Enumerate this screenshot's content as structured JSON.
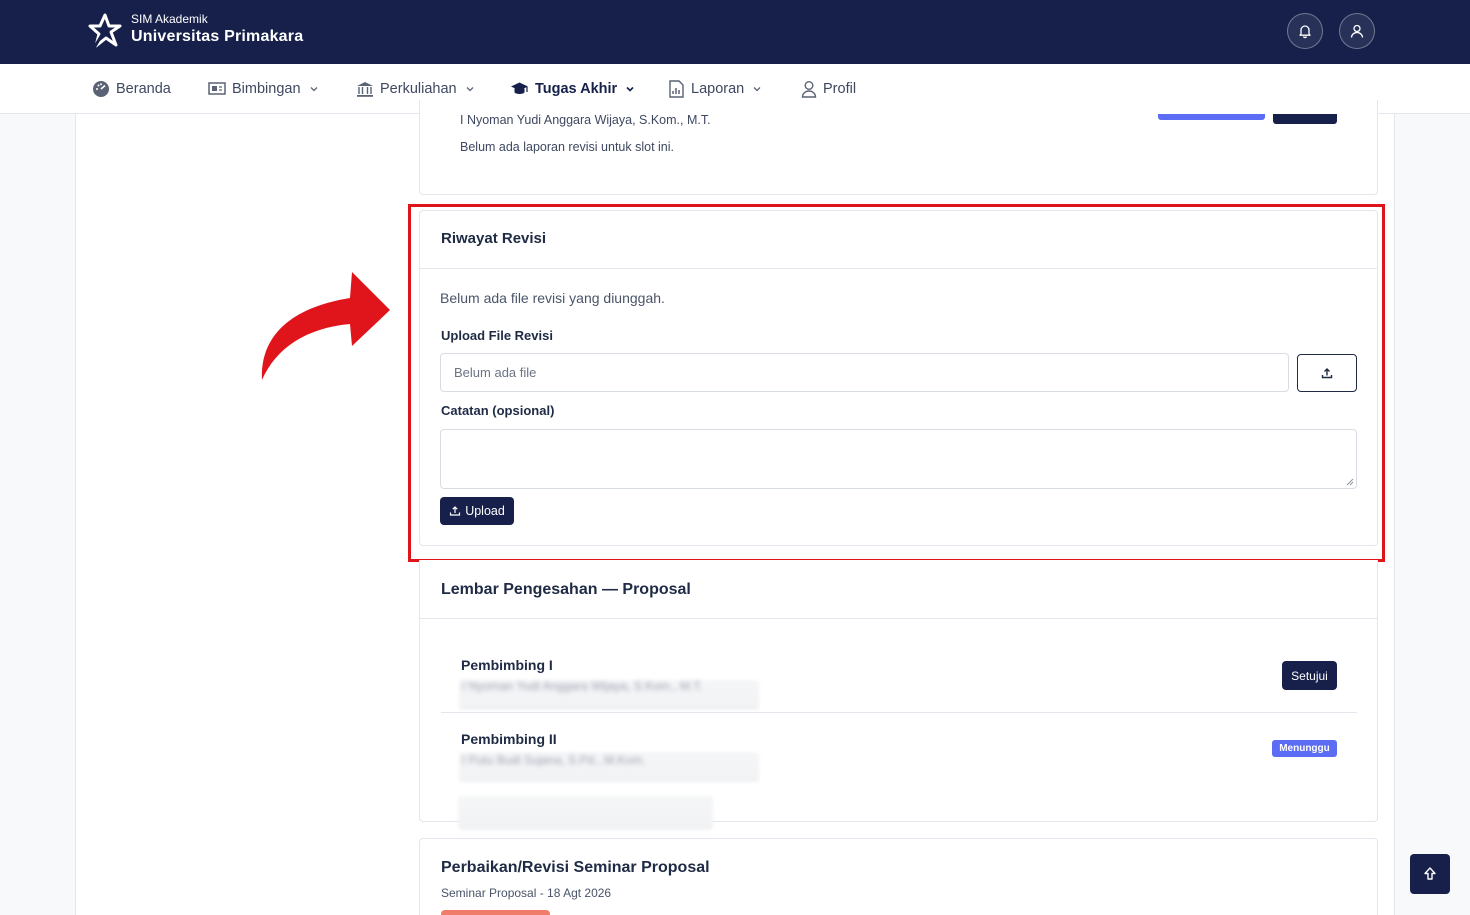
{
  "brand": {
    "sub": "SIM Akademik",
    "name": "Universitas Primakara"
  },
  "nav": {
    "items": [
      {
        "label": "Beranda",
        "icon": "gauge-icon"
      },
      {
        "label": "Bimbingan",
        "icon": "presentation-icon"
      },
      {
        "label": "Perkuliahan",
        "icon": "institution-icon"
      },
      {
        "label": "Tugas Akhir",
        "icon": "graduation-cap-icon",
        "active": true
      },
      {
        "label": "Laporan",
        "icon": "report-icon"
      },
      {
        "label": "Profil",
        "icon": "user-icon"
      }
    ]
  },
  "top_card": {
    "name": "I Nyoman Yudi Anggara Wijaya, S.Kom., M.T.",
    "note": "Belum ada laporan revisi untuk slot ini."
  },
  "revisi": {
    "title": "Riwayat Revisi",
    "empty": "Belum ada file revisi yang diunggah.",
    "file_label": "Upload File Revisi",
    "file_placeholder": "Belum ada file",
    "note_label": "Catatan (opsional)",
    "upload_label": "Upload"
  },
  "pengesahan": {
    "title": "Lembar Pengesahan — Proposal",
    "rows": [
      {
        "label": "Pembimbing I",
        "blurred": "I Nyoman Yudi Anggara Wijaya, S.Kom., M.T.",
        "action": "Setujui"
      },
      {
        "label": "Pembimbing II",
        "blurred": "I Putu Budi Sujana, S.Pd., M.Kom.",
        "status": "Menunggu"
      }
    ]
  },
  "perbaikan": {
    "title": "Perbaikan/Revisi Seminar Proposal",
    "subtitle": "Seminar Proposal - 18 Agt 2026"
  },
  "colors": {
    "navy": "#16204a",
    "accent": "#5b6cf5",
    "highlight": "#e0141b"
  }
}
